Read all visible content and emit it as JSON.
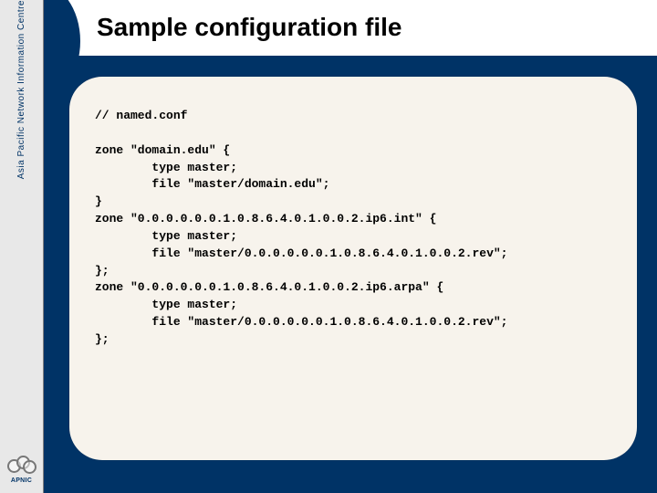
{
  "sidebar": {
    "org_text": "Asia Pacific Network Information Centre",
    "logo_text": "APNIC"
  },
  "title": "Sample configuration file",
  "code": {
    "l01": "// named.conf",
    "l02": "",
    "l03": "zone \"domain.edu\" {",
    "l04": "        type master;",
    "l05": "        file \"master/domain.edu\";",
    "l06": "}",
    "l07": "zone \"0.0.0.0.0.0.1.0.8.6.4.0.1.0.0.2.ip6.int\" {",
    "l08": "        type master;",
    "l09": "        file \"master/0.0.0.0.0.0.1.0.8.6.4.0.1.0.0.2.rev\";",
    "l10": "};",
    "l11": "zone \"0.0.0.0.0.0.1.0.8.6.4.0.1.0.0.2.ip6.arpa\" {",
    "l12": "        type master;",
    "l13": "        file \"master/0.0.0.0.0.0.1.0.8.6.4.0.1.0.0.2.rev\";",
    "l14": "};"
  }
}
